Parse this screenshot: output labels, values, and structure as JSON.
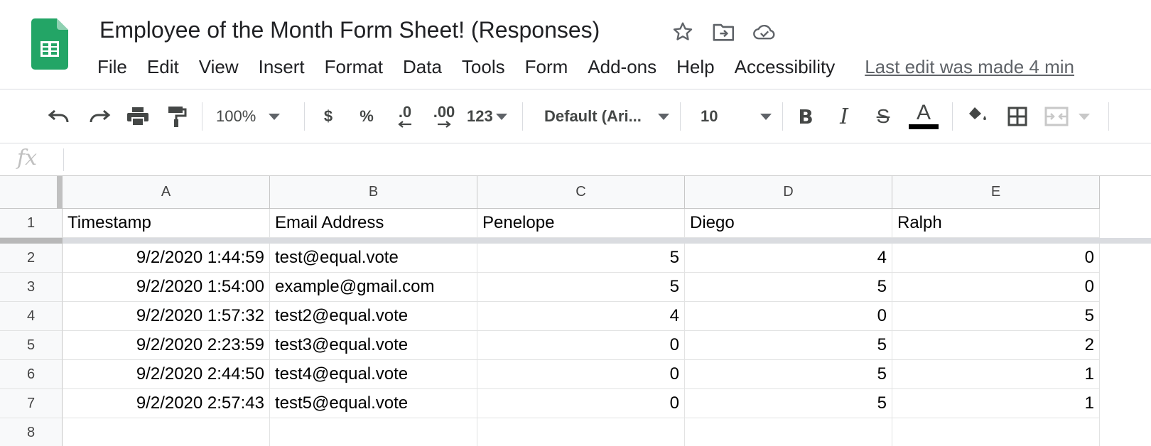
{
  "doc": {
    "title": "Employee of the Month Form Sheet!  (Responses)",
    "icons": [
      "star-icon",
      "move-to-folder-icon",
      "cloud-saved-icon"
    ]
  },
  "menu": {
    "items": [
      "File",
      "Edit",
      "View",
      "Insert",
      "Format",
      "Data",
      "Tools",
      "Form",
      "Add-ons",
      "Help",
      "Accessibility"
    ],
    "last_edit": "Last edit was made 4 min"
  },
  "toolbar": {
    "zoom": "100%",
    "currency": "$",
    "percent": "%",
    "decrease_decimals": ".0",
    "increase_decimals": ".00",
    "more_formats": "123",
    "font": "Default (Ari...",
    "font_size": "10",
    "bold": "B",
    "italic": "I",
    "strikethrough": "S",
    "text_color_letter": "A",
    "text_color": "#000000",
    "icons": [
      "undo-icon",
      "redo-icon",
      "print-icon",
      "paint-format-icon",
      "fill-color-icon",
      "borders-icon",
      "merge-cells-icon"
    ]
  },
  "formula_bar": {
    "label": "fx",
    "value": ""
  },
  "grid": {
    "columns": [
      "A",
      "B",
      "C",
      "D",
      "E"
    ],
    "header_row": {
      "row": "1",
      "cells": [
        "Timestamp",
        "Email Address",
        "Penelope",
        "Diego",
        "Ralph"
      ]
    },
    "rows": [
      {
        "row": "2",
        "cells": [
          "9/2/2020 1:44:59",
          "test@equal.vote",
          "5",
          "4",
          "0"
        ]
      },
      {
        "row": "3",
        "cells": [
          "9/2/2020 1:54:00",
          "example@gmail.com",
          "5",
          "5",
          "0"
        ]
      },
      {
        "row": "4",
        "cells": [
          "9/2/2020 1:57:32",
          "test2@equal.vote",
          "4",
          "0",
          "5"
        ]
      },
      {
        "row": "5",
        "cells": [
          "9/2/2020 2:23:59",
          "test3@equal.vote",
          "0",
          "5",
          "2"
        ]
      },
      {
        "row": "6",
        "cells": [
          "9/2/2020 2:44:50",
          "test4@equal.vote",
          "0",
          "5",
          "1"
        ]
      },
      {
        "row": "7",
        "cells": [
          "9/2/2020 2:57:43",
          "test5@equal.vote",
          "0",
          "5",
          "1"
        ]
      },
      {
        "row": "8",
        "cells": [
          "",
          "",
          "",
          "",
          ""
        ]
      }
    ]
  },
  "colors": {
    "sheets_green": "#0f9d58",
    "sheets_green_dark": "#0b8043",
    "header_bg": "#f8f9fa",
    "gridline": "#e2e3e3",
    "freeze_bar": "#dadce0"
  }
}
